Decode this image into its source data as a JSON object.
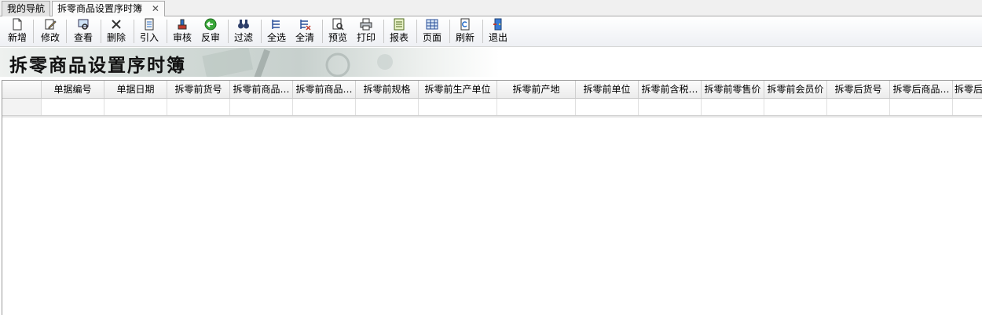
{
  "tabs": [
    {
      "label": "我的导航",
      "active": false
    },
    {
      "label": "拆零商品设置序时簿",
      "active": true,
      "close": "✕"
    }
  ],
  "toolbar": {
    "new": "新增",
    "edit": "修改",
    "view": "查看",
    "delete": "删除",
    "import": "引入",
    "approve": "审核",
    "unapprove": "反审",
    "filter": "过滤",
    "select_all": "全选",
    "clear_all": "全清",
    "preview": "预览",
    "print": "打印",
    "report": "报表",
    "page": "页面",
    "refresh": "刷新",
    "exit": "退出"
  },
  "banner": {
    "title": "拆零商品设置序时簿"
  },
  "grid": {
    "columns": [
      "单据编号",
      "单据日期",
      "拆零前货号",
      "拆零前商品…",
      "拆零前商品…",
      "拆零前规格",
      "拆零前生产单位",
      "拆零前产地",
      "拆零前单位",
      "拆零前含税…",
      "拆零前零售价",
      "拆零前会员价",
      "拆零后货号",
      "拆零后商品…",
      "拆零后"
    ]
  },
  "colors": {
    "accent": "#2a6fc9"
  }
}
